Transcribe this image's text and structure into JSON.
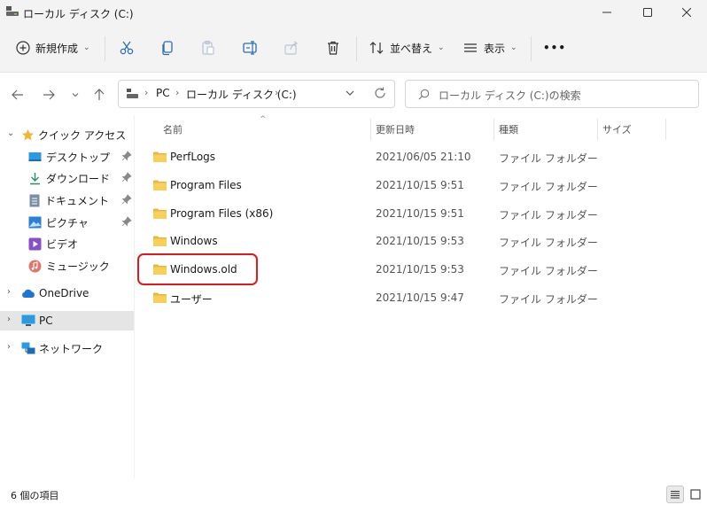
{
  "window": {
    "title": "ローカル ディスク (C:)",
    "minimize_icon": "minimize-icon",
    "maximize_icon": "maximize-icon",
    "close_icon": "close-icon"
  },
  "toolbar": {
    "new_label": "新規作成",
    "sort_label": "並べ替え",
    "view_label": "表示",
    "more_label": "•••"
  },
  "address": {
    "crumbs": [
      "PC",
      "ローカル ディスク (C:)"
    ],
    "search_placeholder": "ローカル ディスク (C:)の検索"
  },
  "nav": {
    "quick_access": "クイック アクセス",
    "items": [
      {
        "label": "デスクトップ"
      },
      {
        "label": "ダウンロード"
      },
      {
        "label": "ドキュメント"
      },
      {
        "label": "ピクチャ"
      },
      {
        "label": "ビデオ"
      },
      {
        "label": "ミュージック"
      }
    ],
    "onedrive": "OneDrive",
    "pc": "PC",
    "network": "ネットワーク"
  },
  "columns": {
    "name": "名前",
    "date": "更新日時",
    "type": "種類",
    "size": "サイズ"
  },
  "files": [
    {
      "name": "PerfLogs",
      "date": "2021/06/05 21:10",
      "type": "ファイル フォルダー"
    },
    {
      "name": "Program Files",
      "date": "2021/10/15 9:51",
      "type": "ファイル フォルダー"
    },
    {
      "name": "Program Files (x86)",
      "date": "2021/10/15 9:51",
      "type": "ファイル フォルダー"
    },
    {
      "name": "Windows",
      "date": "2021/10/15 9:53",
      "type": "ファイル フォルダー"
    },
    {
      "name": "Windows.old",
      "date": "2021/10/15 9:53",
      "type": "ファイル フォルダー"
    },
    {
      "name": "ユーザー",
      "date": "2021/10/15 9:47",
      "type": "ファイル フォルダー"
    }
  ],
  "status": {
    "item_count": "6 個の項目"
  },
  "colors": {
    "highlight": "#e01a1a",
    "folder": "#f4c542",
    "accent": "#0067c0"
  }
}
